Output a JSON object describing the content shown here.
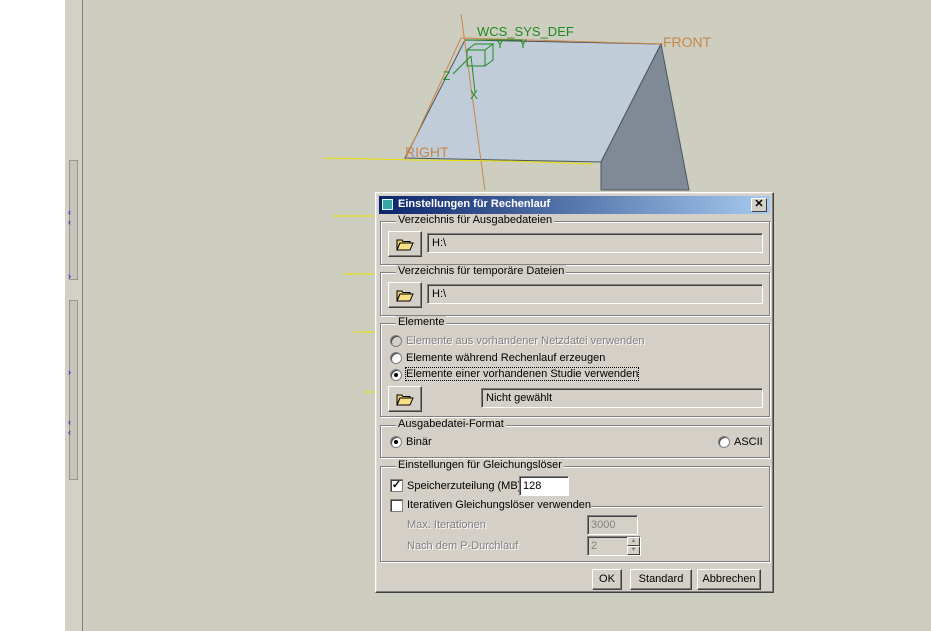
{
  "scene": {
    "csys_label": "WCS_SYS_DEF",
    "front_label": "FRONT",
    "right_label": "RIGHT",
    "axis_y": "Y",
    "axis_y2": "Y",
    "axis_z": "Z",
    "axis_x": "X",
    "colors": {
      "viewport": "#cdcdc0",
      "top_face": "#c0ccd8",
      "side_face": "#808a96",
      "datum": "#c8884a",
      "csys": "#208a20",
      "annotation": "#e00000"
    }
  },
  "dialog": {
    "title": "Einstellungen für Rechenlauf",
    "close_symbol": "✕",
    "output_dir": {
      "legend": "Verzeichnis für Ausgabedateien",
      "value": "H:\\"
    },
    "temp_dir": {
      "legend": "Verzeichnis für temporäre Dateien",
      "value": "H:\\"
    },
    "elements": {
      "legend": "Elemente",
      "options": [
        "Elemente aus vorhandener Netzdatei verwenden",
        "Elemente während Rechenlauf erzeugen",
        "Elemente einer vorhandenen Studie verwenden"
      ],
      "selected_option": "Elemente einer vorhandenen Studie verwenden",
      "study_value": "Nicht gewählt"
    },
    "format": {
      "legend": "Ausgabedatei-Format",
      "binary_label": "Binär",
      "ascii_label": "ASCII",
      "selected": "Binär"
    },
    "solver": {
      "legend": "Einstellungen für Gleichungslöser",
      "memory_label": "Speicherzuteilung (MB)",
      "memory_checked": true,
      "memory_value": "128",
      "iterative_label": "Iterativen Gleichungslöser verwenden",
      "iterative_checked": false,
      "max_iter_label": "Max. Iterationen",
      "max_iter_value": "3000",
      "after_pass_label": "Nach dem P-Durchlauf",
      "after_pass_value": "2"
    },
    "buttons": {
      "ok": "OK",
      "standard": "Standard",
      "cancel": "Abbrechen"
    }
  }
}
